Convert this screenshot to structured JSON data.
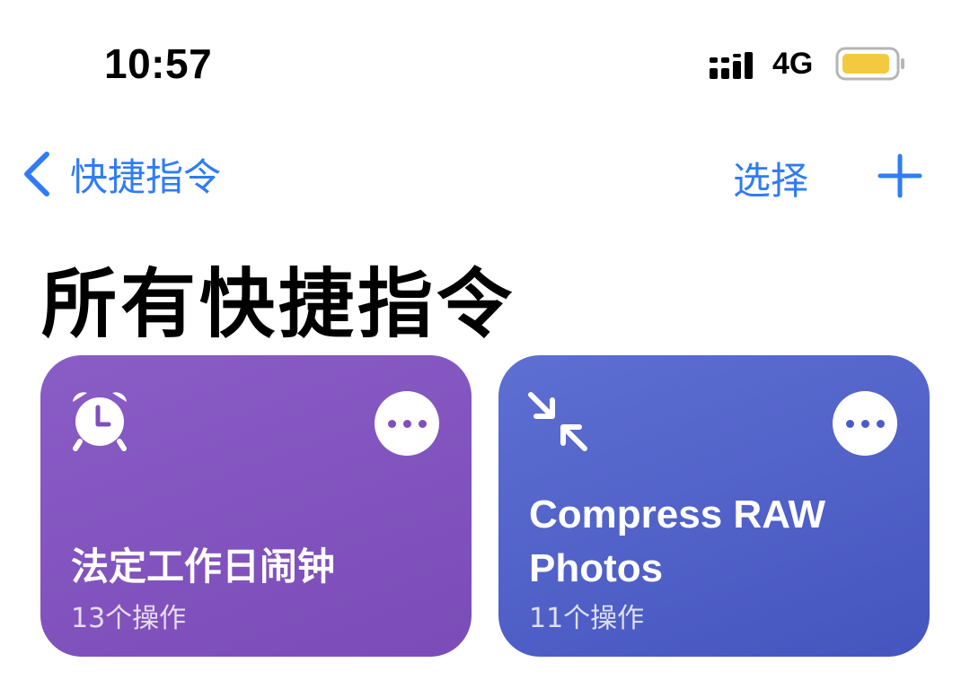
{
  "status_bar": {
    "time": "10:57",
    "network": "4G",
    "battery_color": "#f3c93f"
  },
  "nav": {
    "back_label": "快捷指令",
    "select_label": "选择",
    "accent_color": "#2f7cf6"
  },
  "page": {
    "title": "所有快捷指令"
  },
  "shortcuts": [
    {
      "title": "法定工作日闹钟",
      "subtitle": "13个操作",
      "icon": "alarm-clock-icon",
      "color": "#7f50bd"
    },
    {
      "title_line1": "Compress RAW",
      "title_line2": "Photos",
      "subtitle": "11个操作",
      "icon": "compress-arrows-icon",
      "color": "#4b5cc5"
    }
  ]
}
